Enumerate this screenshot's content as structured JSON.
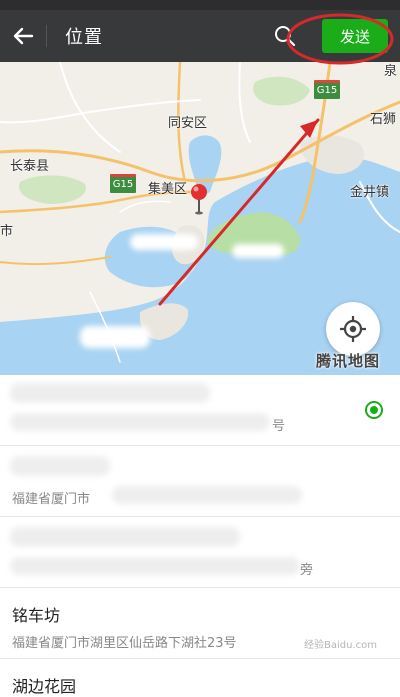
{
  "navbar": {
    "back_icon": "arrow-left-icon",
    "title": "位置",
    "search_icon": "search-icon",
    "send_label": "发送",
    "accent_color": "#1aad19"
  },
  "map": {
    "labels": {
      "tongan": "同安区",
      "changtai": "长泰县",
      "jimei": "集美区",
      "jinjing": "金井镇",
      "shishi": "石狮",
      "quan": "泉",
      "shi": "市"
    },
    "shields": {
      "g15_a": "G15",
      "g15_b": "G15"
    },
    "provider_logo": "腾讯地图",
    "locate_icon": "crosshair-icon",
    "pin_icon": "map-pin-icon",
    "annotation": "red-arrow-and-ellipse"
  },
  "results": [
    {
      "name": "",
      "address": "",
      "selected": true,
      "address_suffix": "号"
    },
    {
      "name": "",
      "address": "福建省厦门市",
      "selected": false
    },
    {
      "name": "",
      "address": "",
      "selected": false,
      "address_suffix": "旁"
    },
    {
      "name": "铭车坊",
      "address": "福建省厦门市湖里区仙岳路下湖社23号",
      "selected": false
    },
    {
      "name": "湖边花园",
      "address": "",
      "selected": false
    }
  ],
  "watermark": "经验Baidu.com"
}
